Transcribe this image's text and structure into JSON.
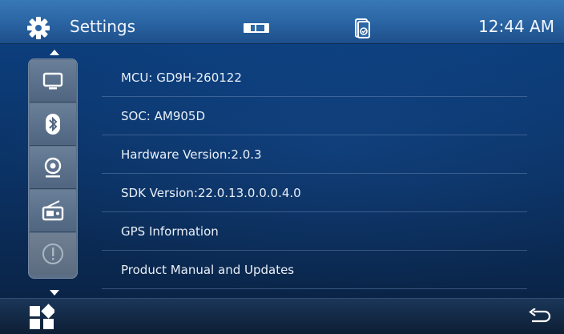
{
  "header": {
    "title": "Settings",
    "time": "12:44 AM"
  },
  "sidebar": {
    "tabs": [
      {
        "icon": "display-icon"
      },
      {
        "icon": "bluetooth-icon"
      },
      {
        "icon": "camera-icon"
      },
      {
        "icon": "radio-icon"
      },
      {
        "icon": "info-icon",
        "selected": true
      }
    ]
  },
  "info_list": {
    "rows": [
      "MCU: GD9H-260122",
      "SOC: AM905D",
      "Hardware Version:2.0.3",
      "SDK Version:22.0.13.0.0.0.4.0",
      "GPS Information",
      "Product Manual and Updates"
    ]
  },
  "colors": {
    "topbar": "#2c67a6",
    "content": "#0b3162",
    "sidebar": "#5b6f86"
  }
}
